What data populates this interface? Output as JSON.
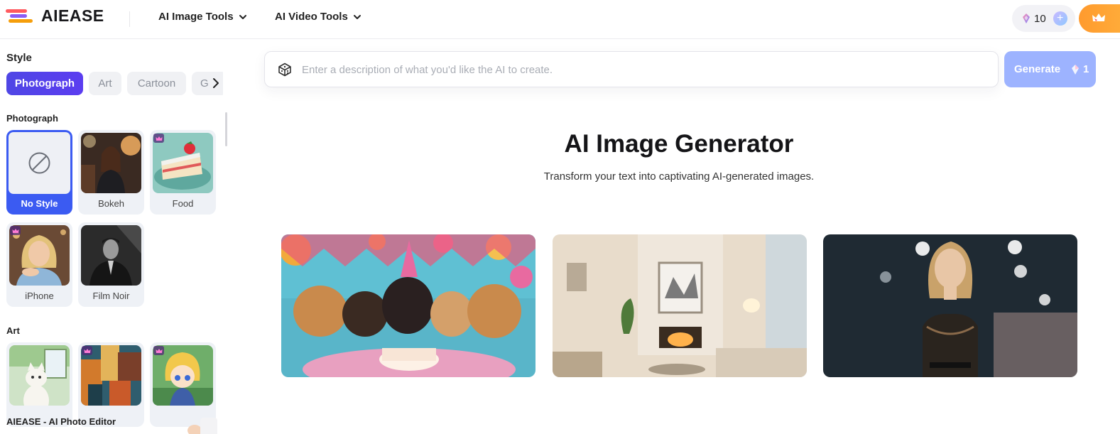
{
  "app": {
    "name": "AIEASE"
  },
  "nav": {
    "image_tools": "AI Image Tools",
    "video_tools": "AI Video Tools"
  },
  "credits": {
    "count": "10"
  },
  "sidebar": {
    "style_title": "Style",
    "tabs": [
      "Photograph",
      "Art",
      "Cartoon",
      "G"
    ],
    "photograph_group": "Photograph",
    "photograph_items": [
      "No Style",
      "Bokeh",
      "Food",
      "iPhone",
      "Film Noir"
    ],
    "art_group": "Art",
    "footer": "AIEASE - AI Photo Editor"
  },
  "prompt": {
    "placeholder": "Enter a description of what you'd like the AI to create."
  },
  "generate": {
    "label": "Generate",
    "cost": "1"
  },
  "hero": {
    "title": "AI Image Generator",
    "subtitle": "Transform your text into captivating AI-generated images."
  },
  "colors": {
    "accent": "#4f46e5",
    "generate_bg": "#9db3ff",
    "premium": "#ffa333",
    "selected_card": "#3b5bf2"
  }
}
